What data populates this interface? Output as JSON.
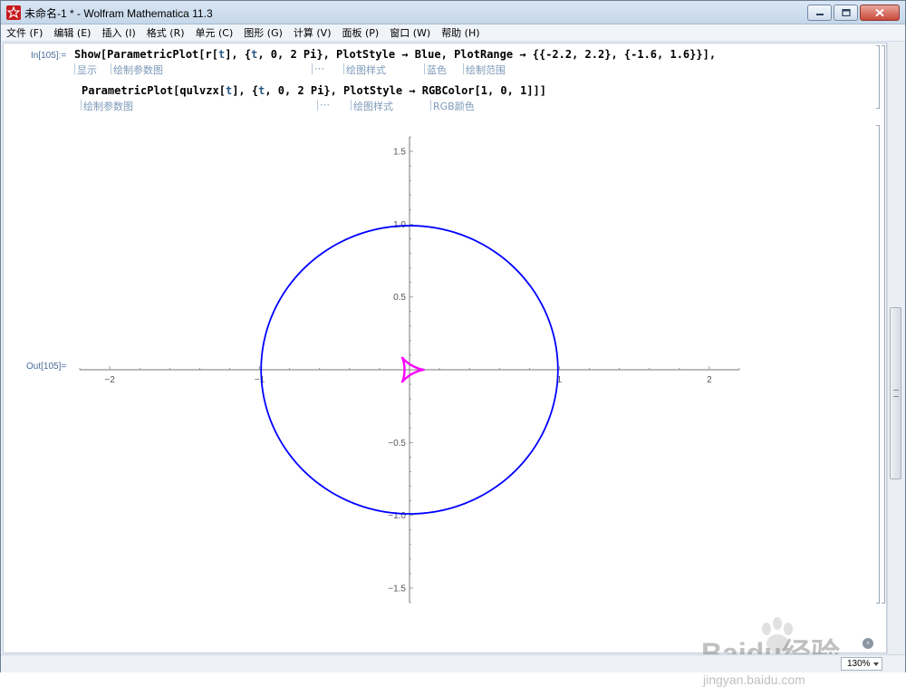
{
  "window": {
    "title": "未命名-1 * - Wolfram Mathematica 11.3"
  },
  "menu": [
    "文件 (F)",
    "编辑 (E)",
    "插入 (I)",
    "格式 (R)",
    "单元 (C)",
    "图形 (G)",
    "计算 (V)",
    "面板 (P)",
    "窗口 (W)",
    "帮助 (H)"
  ],
  "cell_in": {
    "label": "In[105]:=",
    "line1": {
      "code_prefix": "Show[ParametricPlot[r[",
      "var_t": "t",
      "code_mid1": "], {",
      "var_t2": "t",
      "code_rest": ", 0, 2 Pi}, PlotStyle → Blue, PlotRange → {{-2.2, 2.2}, {-1.6, 1.6}}],"
    },
    "line1_annotations": [
      "显示",
      "绘制参数图",
      "⋯",
      "绘图样式",
      "蓝色",
      "绘制范围"
    ],
    "line2": {
      "code_prefix": "ParametricPlot[qulvzx[",
      "var_t": "t",
      "code_mid1": "], {",
      "var_t2": "t",
      "code_rest": ", 0, 2 Pi}, PlotStyle → RGBColor[1, 0, 1]]]"
    },
    "line2_annotations": [
      "绘制参数图",
      "⋯",
      "绘图样式",
      "RGB颜色"
    ]
  },
  "cell_out": {
    "label": "Out[105]="
  },
  "chart_data": {
    "type": "line",
    "xlim": [
      -2.2,
      2.2
    ],
    "ylim": [
      -1.6,
      1.6
    ],
    "x_ticks": [
      -2,
      -1,
      1,
      2
    ],
    "x_tick_labels": [
      "−2",
      "−1",
      "1",
      "2"
    ],
    "y_ticks": [
      -1.5,
      -1.0,
      -0.5,
      0.5,
      1.0,
      1.5
    ],
    "y_tick_labels": [
      "−1.5",
      "−1.0",
      "−0.5",
      "0.5",
      "1.0",
      "1.5"
    ],
    "series": [
      {
        "curve": "circle",
        "color": "#0000ff",
        "radius": 0.99,
        "center": [
          0,
          0
        ]
      },
      {
        "curve": "deltoid",
        "color": "#ff00ff",
        "x": [
          0.1,
          -0.05,
          -0.05,
          0.1
        ],
        "y": [
          0.0,
          0.1,
          -0.1,
          0.0
        ]
      }
    ],
    "axes_origin": [
      0,
      0
    ]
  },
  "status": {
    "zoom": "130%"
  },
  "watermark": {
    "brand": "Baidu经验",
    "url": "jingyan.baidu.com"
  },
  "colors": {
    "code_var": "#2d5a86",
    "annotation": "#7d9ab9",
    "label": "#4a6c9b"
  }
}
